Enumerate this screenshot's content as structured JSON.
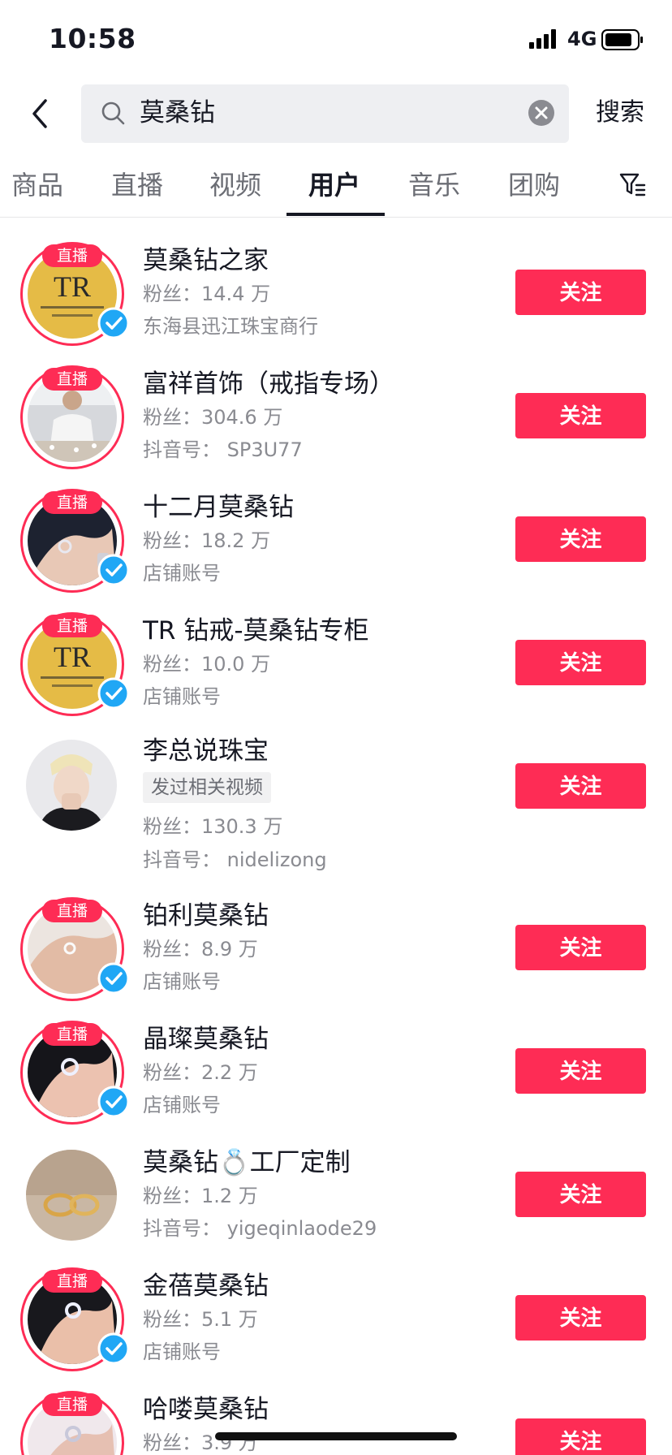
{
  "status_bar": {
    "time": "10:58",
    "network": "4G"
  },
  "search": {
    "query": "莫桑钻",
    "button_label": "搜索"
  },
  "tabs": [
    {
      "label": "商品"
    },
    {
      "label": "直播"
    },
    {
      "label": "视频"
    },
    {
      "label": "用户",
      "active": true
    },
    {
      "label": "音乐"
    },
    {
      "label": "团购"
    }
  ],
  "colors": {
    "accent": "#fe2c55",
    "verified": "#20a7f5",
    "text": "#161823",
    "subtext": "#8a8b91"
  },
  "results": [
    {
      "name": "莫桑钻之家",
      "fans": "粉丝：14.4 万",
      "extra": "东海县迅江珠宝商行",
      "live_badge": "直播",
      "verified": true,
      "avatar": "TR-logo",
      "follow": "关注"
    },
    {
      "name": "富祥首饰（戒指专场）",
      "fans": "粉丝：304.6 万",
      "extra": "抖音号： SP3U77",
      "live_badge": "直播",
      "verified": false,
      "avatar": "man-photo",
      "follow": "关注"
    },
    {
      "name": "十二月莫桑钻",
      "fans": "粉丝：18.2 万",
      "extra": "店铺账号",
      "live_badge": "直播",
      "verified": true,
      "avatar": "hand-ring-dark",
      "follow": "关注"
    },
    {
      "name": "TR 钻戒-莫桑钻专柜",
      "fans": "粉丝：10.0 万",
      "extra": "店铺账号",
      "live_badge": "直播",
      "verified": true,
      "avatar": "TR-logo",
      "follow": "关注"
    },
    {
      "name": "李总说珠宝",
      "tag": "发过相关视频",
      "fans": "粉丝：130.3 万",
      "extra": "抖音号： nidelizong",
      "verified": false,
      "avatar": "person-photo",
      "follow": "关注"
    },
    {
      "name": "铂利莫桑钻",
      "fans": "粉丝：8.9 万",
      "extra": "店铺账号",
      "live_badge": "直播",
      "verified": true,
      "avatar": "hand-ring-light",
      "follow": "关注"
    },
    {
      "name": "晶璨莫桑钻",
      "fans": "粉丝：2.2 万",
      "extra": "店铺账号",
      "live_badge": "直播",
      "verified": true,
      "avatar": "hand-ring-dark",
      "follow": "关注"
    },
    {
      "name": "莫桑钻💍工厂定制",
      "fans": "粉丝：1.2 万",
      "extra": "抖音号： yigeqinlaode29",
      "verified": false,
      "avatar": "gold-rings",
      "follow": "关注"
    },
    {
      "name": "金蓓莫桑钻",
      "fans": "粉丝：5.1 万",
      "extra": "店铺账号",
      "live_badge": "直播",
      "verified": true,
      "avatar": "hand-ring-dark",
      "follow": "关注"
    },
    {
      "name": "哈喽莫桑钻",
      "fans": "粉丝：3.9 万",
      "live_badge": "直播",
      "verified": false,
      "avatar": "hand-ring-light",
      "follow": "关注"
    }
  ]
}
